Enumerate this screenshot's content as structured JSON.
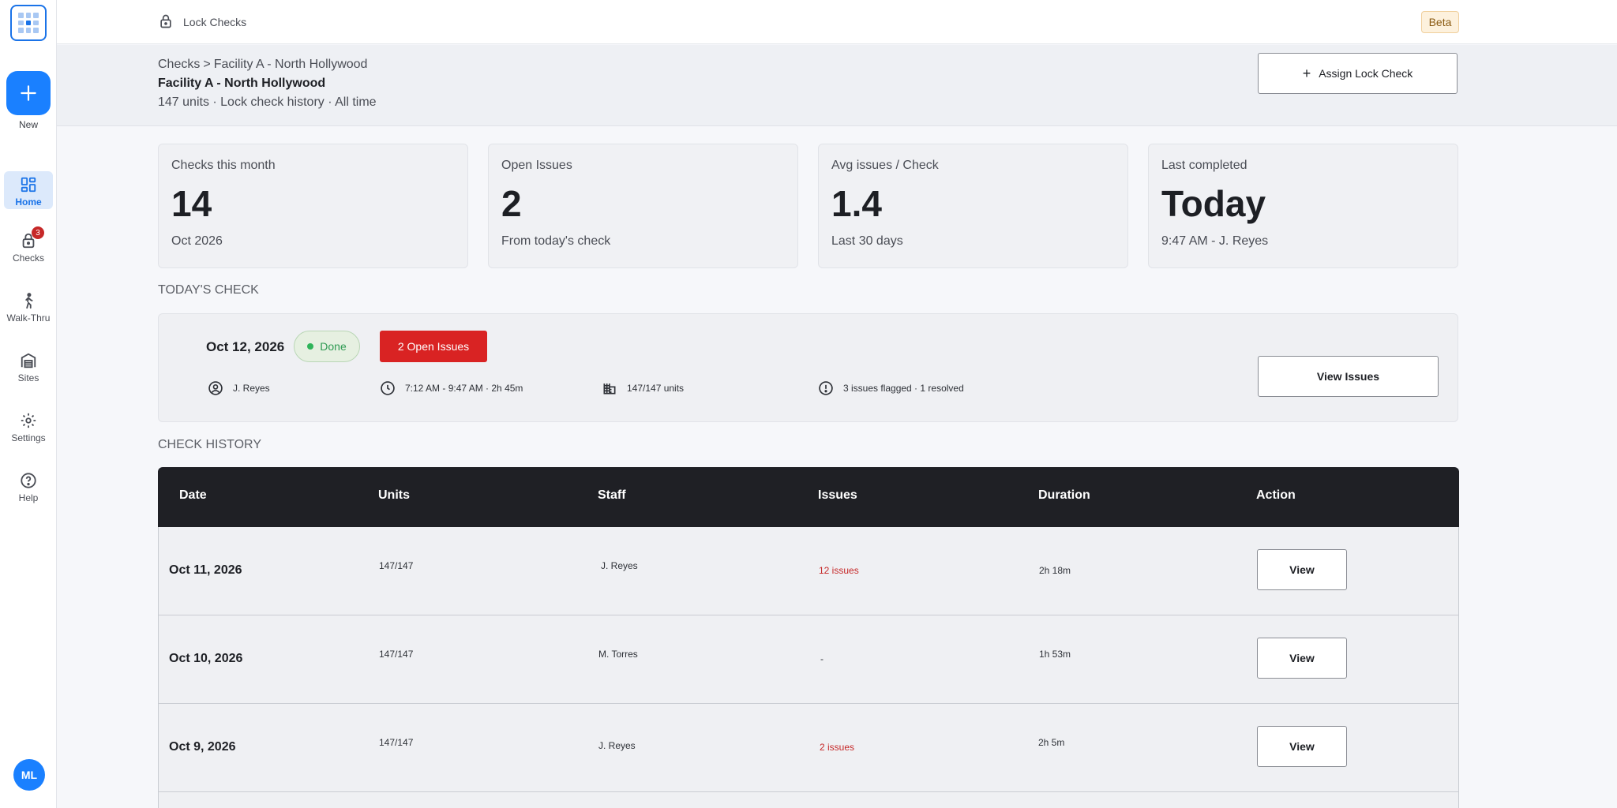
{
  "sidebar": {
    "new_label": "New",
    "items": [
      {
        "label": "Home",
        "icon": "dashboard-icon",
        "active": true
      },
      {
        "label": "Checks",
        "icon": "lock-icon",
        "badge": "3"
      },
      {
        "label": "Walk-Thru",
        "icon": "walking-person-icon"
      },
      {
        "label": "Sites",
        "icon": "building-icon"
      },
      {
        "label": "Settings",
        "icon": "gear-icon"
      },
      {
        "label": "Help",
        "icon": "help-icon"
      }
    ],
    "avatar_initials": "ML"
  },
  "topbar": {
    "app_title": "Lock Checks",
    "beta_label": "Beta"
  },
  "header": {
    "breadcrumb_root": "Checks",
    "breadcrumb_separator": ">",
    "breadcrumb_current": "Facility A - North Hollywood",
    "title": "Facility A - North Hollywood",
    "subtitle": "147 units · Lock check history · All time",
    "assign_button": "Assign Lock Check"
  },
  "stats": [
    {
      "label": "Checks this month",
      "value": "14",
      "sub": "Oct 2026"
    },
    {
      "label": "Open Issues",
      "value": "2",
      "sub": "From today's check"
    },
    {
      "label": "Avg issues / Check",
      "value": "1.4",
      "sub": "Last 30 days"
    },
    {
      "label": "Last completed",
      "value": "Today",
      "sub": "9:47 AM - J. Reyes"
    }
  ],
  "today": {
    "section_title": "TODAY'S CHECK",
    "date": "Oct 12, 2026",
    "status": "Done",
    "issues_button": "2 Open Issues",
    "staff": "J. Reyes",
    "time": "7:12 AM - 9:47 AM  · 2h 45m",
    "units": "147/147 units",
    "issues_summary": "3 issues flagged · 1 resolved",
    "view_issues_button": "View Issues"
  },
  "history": {
    "section_title": "CHECK HISTORY",
    "columns": [
      "Date",
      "Units",
      "Staff",
      "Issues",
      "Duration",
      "Action"
    ],
    "rows": [
      {
        "date": "Oct 11, 2026",
        "units": "147/147",
        "staff": "J. Reyes",
        "issues": "12 issues",
        "duration": "2h 18m",
        "action": "View"
      },
      {
        "date": "Oct 10, 2026",
        "units": "147/147",
        "staff": "M. Torres",
        "issues": "-",
        "duration": "1h 53m",
        "action": "View"
      },
      {
        "date": "Oct 9, 2026",
        "units": "147/147",
        "staff": "J. Reyes",
        "issues": "2 issues",
        "duration": "2h 5m",
        "action": "View"
      }
    ]
  },
  "colors": {
    "accent": "#1a80ff",
    "danger": "#d92323",
    "success": "#2fb45a",
    "table_header": "#1f2025"
  }
}
